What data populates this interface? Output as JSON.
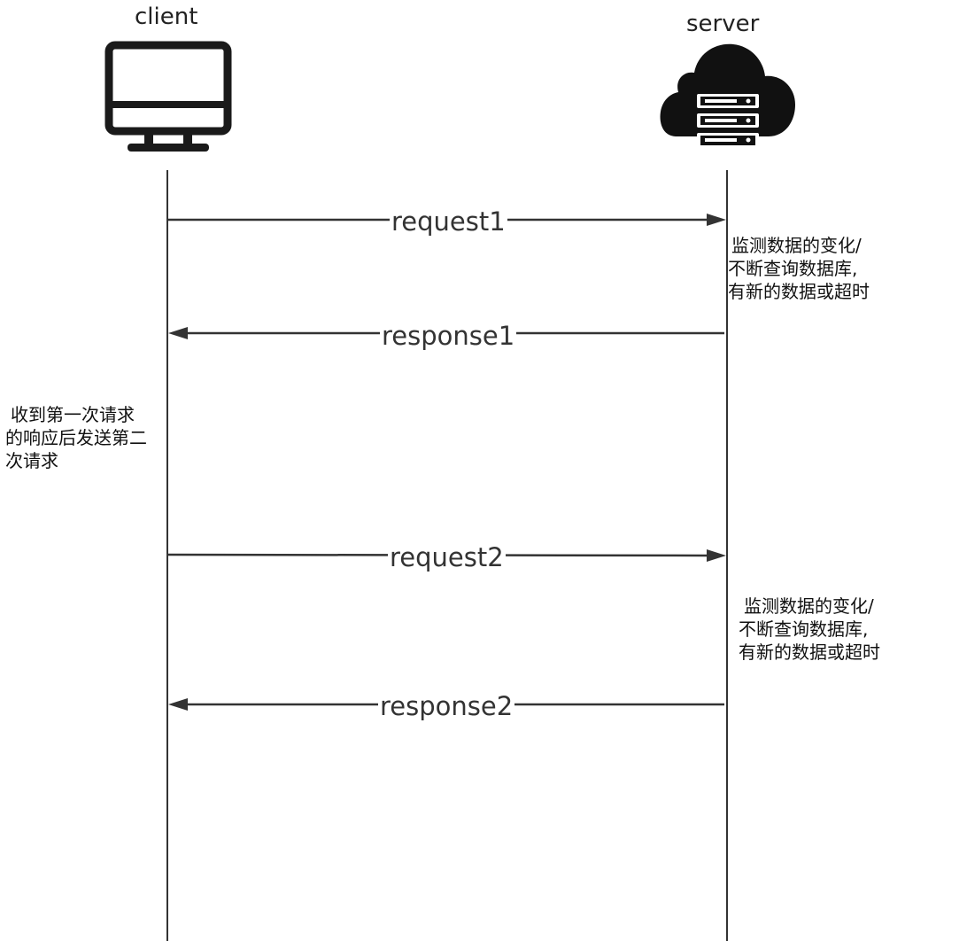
{
  "actors": {
    "client": {
      "label": "client",
      "icon": "monitor-icon"
    },
    "server": {
      "label": "server",
      "icon": "cloud-server-icon"
    }
  },
  "messages": [
    {
      "label": "request1",
      "direction": "client-to-server"
    },
    {
      "label": "response1",
      "direction": "server-to-client"
    },
    {
      "label": "request2",
      "direction": "client-to-server"
    },
    {
      "label": "response2",
      "direction": "server-to-client"
    }
  ],
  "notes": {
    "server_note_1": [
      "监测数据的变化/",
      "不断查询数据库,",
      "有新的数据或超时"
    ],
    "client_note": [
      "收到第一次请求",
      "的响应后发送第二",
      "次请求"
    ],
    "server_note_2": [
      "监测数据的变化/",
      "不断查询数据库,",
      "有新的数据或超时"
    ]
  },
  "colors": {
    "line": "#333333",
    "icon": "#1a1a1a"
  }
}
